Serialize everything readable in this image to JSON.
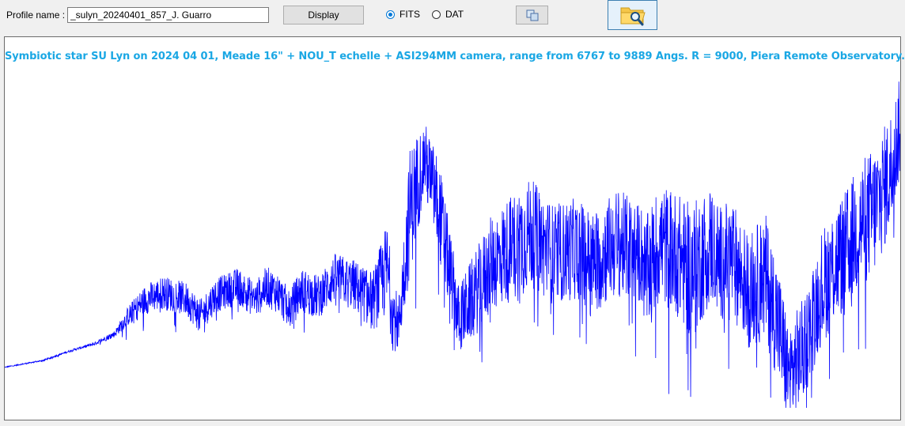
{
  "toolbar": {
    "profile_label": "Profile name :",
    "profile_value": "_sulyn_20240401_857_J. Guarro",
    "display_label": "Display",
    "format_options": [
      {
        "label": "FITS",
        "selected": true
      },
      {
        "label": "DAT",
        "selected": false
      }
    ],
    "copy_icon": "copy-icon",
    "open_icon": "folder-search-icon"
  },
  "plot": {
    "title": "Symbiotic star SU Lyn on 2024 04 01, Meade 16\" + NOU_T echelle + ASI294MM camera, range from 6767 to 9889 Angs. R = 9000, Piera Remote Observatory.",
    "line_color": "#0000ff",
    "title_color": "#1aa7e4"
  },
  "chart_data": {
    "type": "line",
    "title": "Symbiotic star SU Lyn on 2024 04 01, Meade 16\" + NOU_T echelle + ASI294MM camera, range from 6767 to 9889 Angs. R = 9000, Piera Remote Observatory.",
    "xlabel": "",
    "ylabel": "",
    "xlim": [
      6767,
      9889
    ],
    "ylim": [
      0,
      1
    ],
    "grid": false,
    "series": [
      {
        "x": [
          6767,
          6900,
          7000,
          7080,
          7150,
          7200,
          7260,
          7320,
          7400,
          7450,
          7500,
          7580,
          7640,
          7680,
          7720,
          7760,
          7800,
          7860,
          7920,
          7980,
          8050,
          8100,
          8120,
          8140,
          8180,
          8230,
          8280,
          8350,
          8420,
          8460,
          8500,
          8560,
          8600,
          8680,
          8760,
          8820,
          8900,
          8990,
          9000,
          9050,
          9100,
          9160,
          9230,
          9260,
          9300,
          9360,
          9420,
          9460,
          9500,
          9560,
          9610,
          9660,
          9700,
          9750,
          9800,
          9850,
          9889
        ],
        "values": [
          0.12,
          0.14,
          0.17,
          0.19,
          0.22,
          0.28,
          0.33,
          0.35,
          0.33,
          0.28,
          0.34,
          0.37,
          0.33,
          0.37,
          0.35,
          0.3,
          0.36,
          0.34,
          0.4,
          0.38,
          0.33,
          0.44,
          0.3,
          0.26,
          0.62,
          0.76,
          0.62,
          0.28,
          0.38,
          0.45,
          0.48,
          0.52,
          0.55,
          0.48,
          0.5,
          0.46,
          0.52,
          0.48,
          0.42,
          0.52,
          0.5,
          0.44,
          0.52,
          0.46,
          0.48,
          0.38,
          0.42,
          0.3,
          0.12,
          0.22,
          0.38,
          0.46,
          0.5,
          0.58,
          0.62,
          0.72,
          0.86
        ],
        "amplitude": [
          0.003,
          0.004,
          0.006,
          0.01,
          0.02,
          0.06,
          0.09,
          0.1,
          0.1,
          0.1,
          0.1,
          0.11,
          0.11,
          0.12,
          0.12,
          0.12,
          0.13,
          0.13,
          0.14,
          0.15,
          0.18,
          0.28,
          0.22,
          0.16,
          0.38,
          0.22,
          0.3,
          0.2,
          0.26,
          0.28,
          0.3,
          0.34,
          0.32,
          0.3,
          0.3,
          0.3,
          0.32,
          0.3,
          0.34,
          0.36,
          0.36,
          0.4,
          0.36,
          0.34,
          0.34,
          0.34,
          0.38,
          0.36,
          0.32,
          0.3,
          0.34,
          0.36,
          0.36,
          0.38,
          0.38,
          0.36,
          0.3
        ]
      }
    ]
  }
}
